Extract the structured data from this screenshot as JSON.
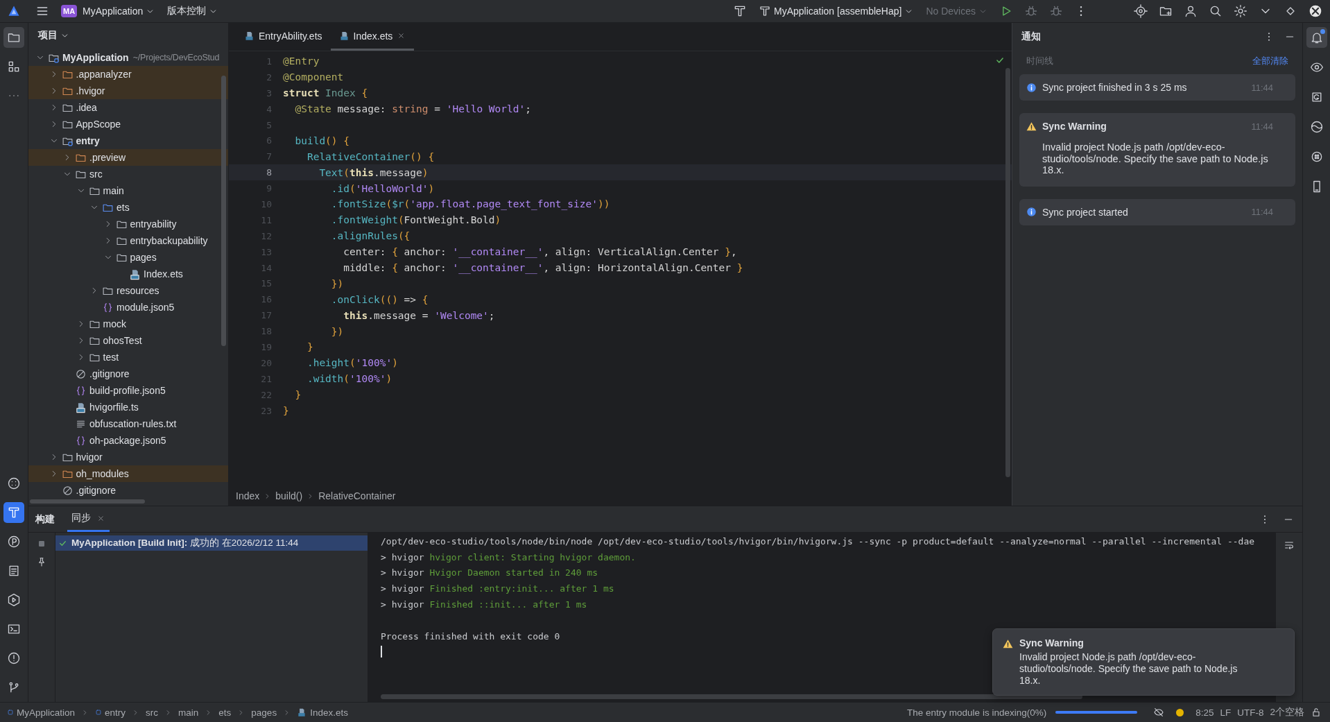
{
  "top_bar": {
    "project_badge": "MA",
    "project": "MyApplication",
    "vcs": "版本控制",
    "run_config": "MyApplication [assembleHap]",
    "device": "No Devices"
  },
  "left_tools_top": [
    {
      "kind": "project",
      "selected": true
    },
    {
      "kind": "structure",
      "selected": false
    },
    {
      "kind": "more",
      "selected": false
    }
  ],
  "left_tools_bottom": [
    {
      "kind": "services",
      "selected": false
    },
    {
      "kind": "build",
      "selected": true
    },
    {
      "kind": "profiler",
      "selected": false
    },
    {
      "kind": "todo",
      "selected": false
    },
    {
      "kind": "run",
      "selected": false
    },
    {
      "kind": "terminal",
      "selected": false
    },
    {
      "kind": "problems",
      "selected": false
    },
    {
      "kind": "vcs",
      "selected": false
    }
  ],
  "right_tools": [
    {
      "kind": "notifications",
      "selected": true,
      "unread": true
    },
    {
      "kind": "preview",
      "selected": false
    },
    {
      "kind": "codegenie",
      "selected": false
    },
    {
      "kind": "globe",
      "selected": false
    },
    {
      "kind": "assistant",
      "selected": false
    },
    {
      "kind": "device",
      "selected": false
    }
  ],
  "project_panel": {
    "title": "项目",
    "tree": [
      {
        "name": "MyApplication",
        "kind": "module",
        "note": "~/Projects/DevEcoStud",
        "expanded": true,
        "excluded": false,
        "children": [
          {
            "name": ".appanalyzer",
            "kind": "folder",
            "expanded": false,
            "excluded": true
          },
          {
            "name": ".hvigor",
            "kind": "folder",
            "expanded": false,
            "excluded": true
          },
          {
            "name": ".idea",
            "kind": "folder",
            "expanded": false,
            "excluded": false
          },
          {
            "name": "AppScope",
            "kind": "folder",
            "expanded": false,
            "excluded": false
          },
          {
            "name": "entry",
            "kind": "module",
            "expanded": true,
            "excluded": false,
            "children": [
              {
                "name": ".preview",
                "kind": "folder",
                "expanded": false,
                "excluded": true
              },
              {
                "name": "src",
                "kind": "folder",
                "expanded": true,
                "excluded": false,
                "children": [
                  {
                    "name": "main",
                    "kind": "folder",
                    "expanded": true,
                    "excluded": false,
                    "children": [
                      {
                        "name": "ets",
                        "kind": "source",
                        "expanded": true,
                        "excluded": false,
                        "children": [
                          {
                            "name": "entryability",
                            "kind": "folder",
                            "expanded": false,
                            "excluded": false
                          },
                          {
                            "name": "entrybackupability",
                            "kind": "folder",
                            "expanded": false,
                            "excluded": false
                          },
                          {
                            "name": "pages",
                            "kind": "folder",
                            "expanded": true,
                            "excluded": false,
                            "children": [
                              {
                                "name": "Index.ets",
                                "kind": "ets",
                                "excluded": false
                              }
                            ]
                          }
                        ]
                      },
                      {
                        "name": "resources",
                        "kind": "folder",
                        "expanded": false,
                        "excluded": false
                      },
                      {
                        "name": "module.json5",
                        "kind": "json",
                        "excluded": false
                      }
                    ]
                  },
                  {
                    "name": "mock",
                    "kind": "folder",
                    "expanded": false,
                    "excluded": false
                  },
                  {
                    "name": "ohosTest",
                    "kind": "folder",
                    "expanded": false,
                    "excluded": false
                  },
                  {
                    "name": "test",
                    "kind": "folder",
                    "expanded": false,
                    "excluded": false
                  }
                ]
              },
              {
                "name": ".gitignore",
                "kind": "ignore",
                "excluded": false
              },
              {
                "name": "build-profile.json5",
                "kind": "json",
                "excluded": false
              },
              {
                "name": "hvigorfile.ts",
                "kind": "ts",
                "excluded": false
              },
              {
                "name": "obfuscation-rules.txt",
                "kind": "text",
                "excluded": false
              },
              {
                "name": "oh-package.json5",
                "kind": "json",
                "excluded": false
              }
            ]
          },
          {
            "name": "hvigor",
            "kind": "folder",
            "expanded": false,
            "excluded": false
          },
          {
            "name": "oh_modules",
            "kind": "folder",
            "expanded": false,
            "excluded": true
          },
          {
            "name": ".gitignore",
            "kind": "ignore",
            "excluded": false
          }
        ]
      }
    ]
  },
  "editor": {
    "tabs": [
      {
        "label": "EntryAbility.ets",
        "selected": false
      },
      {
        "label": "Index.ets",
        "selected": true
      }
    ],
    "lines": [
      {
        "number": "1",
        "current": false,
        "tokens": [
          {
            "kind": "ann",
            "text": "@Entry"
          }
        ]
      },
      {
        "number": "2",
        "current": false,
        "tokens": [
          {
            "kind": "ann",
            "text": "@Component"
          }
        ]
      },
      {
        "number": "3",
        "current": false,
        "tokens": [
          {
            "kind": "kw",
            "text": "struct "
          },
          {
            "kind": "type",
            "text": "Index "
          },
          {
            "kind": "punc",
            "text": "{"
          }
        ]
      },
      {
        "number": "4",
        "current": false,
        "tokens": [
          {
            "kind": "ann",
            "text": "  @State"
          },
          {
            "kind": "plain",
            "text": " message: "
          },
          {
            "kind": "prim",
            "text": "string"
          },
          {
            "kind": "plain",
            "text": " = "
          },
          {
            "kind": "str",
            "text": "'Hello World'"
          },
          {
            "kind": "plain",
            "text": ";"
          }
        ]
      },
      {
        "number": "5",
        "current": false
      },
      {
        "number": "6",
        "current": false,
        "tokens": [
          {
            "kind": "fn",
            "text": "  build"
          },
          {
            "kind": "punc",
            "text": "() {"
          }
        ]
      },
      {
        "number": "7",
        "current": false,
        "tokens": [
          {
            "kind": "fn",
            "text": "    RelativeContainer"
          },
          {
            "kind": "punc",
            "text": "() {"
          }
        ]
      },
      {
        "number": "8",
        "current": true,
        "tokens": [
          {
            "kind": "fn",
            "text": "      Text"
          },
          {
            "kind": "punc",
            "text": "("
          },
          {
            "kind": "kw",
            "text": "this"
          },
          {
            "kind": "plain",
            "text": ".message"
          },
          {
            "kind": "punc",
            "text": ")"
          }
        ]
      },
      {
        "number": "9",
        "current": false,
        "tokens": [
          {
            "kind": "fn",
            "text": "        .id"
          },
          {
            "kind": "punc",
            "text": "("
          },
          {
            "kind": "str",
            "text": "'HelloWorld'"
          },
          {
            "kind": "punc",
            "text": ")"
          }
        ]
      },
      {
        "number": "10",
        "current": false,
        "tokens": [
          {
            "kind": "fn",
            "text": "        .fontSize"
          },
          {
            "kind": "punc",
            "text": "("
          },
          {
            "kind": "fn",
            "text": "$r"
          },
          {
            "kind": "punc",
            "text": "("
          },
          {
            "kind": "str",
            "text": "'app.float.page_text_font_size'"
          },
          {
            "kind": "punc",
            "text": "))"
          }
        ]
      },
      {
        "number": "11",
        "current": false,
        "tokens": [
          {
            "kind": "fn",
            "text": "        .fontWeight"
          },
          {
            "kind": "punc",
            "text": "("
          },
          {
            "kind": "plain",
            "text": "FontWeight.Bold"
          },
          {
            "kind": "punc",
            "text": ")"
          }
        ]
      },
      {
        "number": "12",
        "current": false,
        "tokens": [
          {
            "kind": "fn",
            "text": "        .alignRules"
          },
          {
            "kind": "punc",
            "text": "({"
          }
        ]
      },
      {
        "number": "13",
        "current": false,
        "tokens": [
          {
            "kind": "plain",
            "text": "          center: "
          },
          {
            "kind": "punc",
            "text": "{"
          },
          {
            "kind": "plain",
            "text": " anchor: "
          },
          {
            "kind": "str",
            "text": "'__container__'"
          },
          {
            "kind": "plain",
            "text": ", align: VerticalAlign.Center "
          },
          {
            "kind": "punc",
            "text": "}"
          },
          {
            "kind": "plain",
            "text": ","
          }
        ]
      },
      {
        "number": "14",
        "current": false,
        "tokens": [
          {
            "kind": "plain",
            "text": "          middle: "
          },
          {
            "kind": "punc",
            "text": "{"
          },
          {
            "kind": "plain",
            "text": " anchor: "
          },
          {
            "kind": "str",
            "text": "'__container__'"
          },
          {
            "kind": "plain",
            "text": ", align: HorizontalAlign.Center "
          },
          {
            "kind": "punc",
            "text": "}"
          }
        ]
      },
      {
        "number": "15",
        "current": false,
        "tokens": [
          {
            "kind": "punc",
            "text": "        })"
          }
        ]
      },
      {
        "number": "16",
        "current": false,
        "tokens": [
          {
            "kind": "fn",
            "text": "        .onClick"
          },
          {
            "kind": "punc",
            "text": "(()"
          },
          {
            "kind": "plain",
            "text": " => "
          },
          {
            "kind": "punc",
            "text": "{"
          }
        ]
      },
      {
        "number": "17",
        "current": false,
        "tokens": [
          {
            "kind": "kw",
            "text": "          this"
          },
          {
            "kind": "plain",
            "text": ".message = "
          },
          {
            "kind": "str",
            "text": "'Welcome'"
          },
          {
            "kind": "plain",
            "text": ";"
          }
        ]
      },
      {
        "number": "18",
        "current": false,
        "tokens": [
          {
            "kind": "punc",
            "text": "        })"
          }
        ]
      },
      {
        "number": "19",
        "current": false,
        "tokens": [
          {
            "kind": "punc",
            "text": "    }"
          }
        ]
      },
      {
        "number": "20",
        "current": false,
        "tokens": [
          {
            "kind": "fn",
            "text": "    .height"
          },
          {
            "kind": "punc",
            "text": "("
          },
          {
            "kind": "str",
            "text": "'100%'"
          },
          {
            "kind": "punc",
            "text": ")"
          }
        ]
      },
      {
        "number": "21",
        "current": false,
        "tokens": [
          {
            "kind": "fn",
            "text": "    .width"
          },
          {
            "kind": "punc",
            "text": "("
          },
          {
            "kind": "str",
            "text": "'100%'"
          },
          {
            "kind": "punc",
            "text": ")"
          }
        ]
      },
      {
        "number": "22",
        "current": false,
        "tokens": [
          {
            "kind": "punc",
            "text": "  }"
          }
        ]
      },
      {
        "number": "23",
        "current": false,
        "tokens": [
          {
            "kind": "punc",
            "text": "}"
          }
        ]
      }
    ],
    "breadcrumbs": [
      "Index",
      "build()",
      "RelativeContainer"
    ]
  },
  "notifications": {
    "title": "通知",
    "subtitle": "时间线",
    "clear_all": "全部清除",
    "items": [
      {
        "kind": "info",
        "title": "Sync project finished in 3 s 25 ms",
        "time": "11:44"
      },
      {
        "kind": "warning",
        "title": "Sync Warning",
        "body": "Invalid project Node.js path /opt/dev-eco-studio/tools/node. Specify the save path to Node.js 18.x.",
        "time": "11:44"
      },
      {
        "kind": "info",
        "title": "Sync project started",
        "time": "11:44"
      }
    ]
  },
  "build_panel": {
    "title": "构建",
    "tabs": [
      {
        "label": "同步",
        "selected": true
      }
    ],
    "tree": [
      {
        "selected": true,
        "text": "**MyApplication [Build Init]:** 成功的 在2026/2/12 11:44"
      }
    ],
    "console": [
      {
        "kind": "command",
        "text": "/opt/dev-eco-studio/tools/node/bin/node /opt/dev-eco-studio/tools/hvigor/bin/hvigorw.js --sync -p product=default --analyze=normal --parallel --incremental --dae"
      },
      {
        "kind": "log",
        "prefix": "> hvigor",
        "text": "hvigor client: Starting hvigor daemon."
      },
      {
        "kind": "log",
        "prefix": "> hvigor",
        "text": "Hvigor Daemon started in 240 ms"
      },
      {
        "kind": "log",
        "prefix": "> hvigor",
        "text": "Finished :entry:init... after 1 ms"
      },
      {
        "kind": "log",
        "prefix": "> hvigor",
        "text": "Finished ::init... after 1 ms"
      },
      {
        "kind": "blank"
      },
      {
        "kind": "command",
        "text": "Process finished with exit code 0"
      }
    ]
  },
  "toast": {
    "kind": "warning",
    "title": "Sync Warning",
    "body": "Invalid project Node.js path /opt/dev-eco-studio/tools/node. Specify the save path to Node.js 18.x."
  },
  "status_bar": {
    "path": [
      {
        "label": "MyApplication",
        "kind": "module"
      },
      {
        "label": "entry",
        "kind": "module"
      },
      {
        "label": "src",
        "kind": "folder"
      },
      {
        "label": "main",
        "kind": "folder"
      },
      {
        "label": "ets",
        "kind": "folder"
      },
      {
        "label": "pages",
        "kind": "folder"
      },
      {
        "label": "Index.ets",
        "kind": "ets"
      }
    ],
    "task": "The entry module is indexing(0%)",
    "level": 1,
    "position": "8:25",
    "line_separator": "LF",
    "encoding": "UTF-8",
    "indent": "2个空格"
  }
}
